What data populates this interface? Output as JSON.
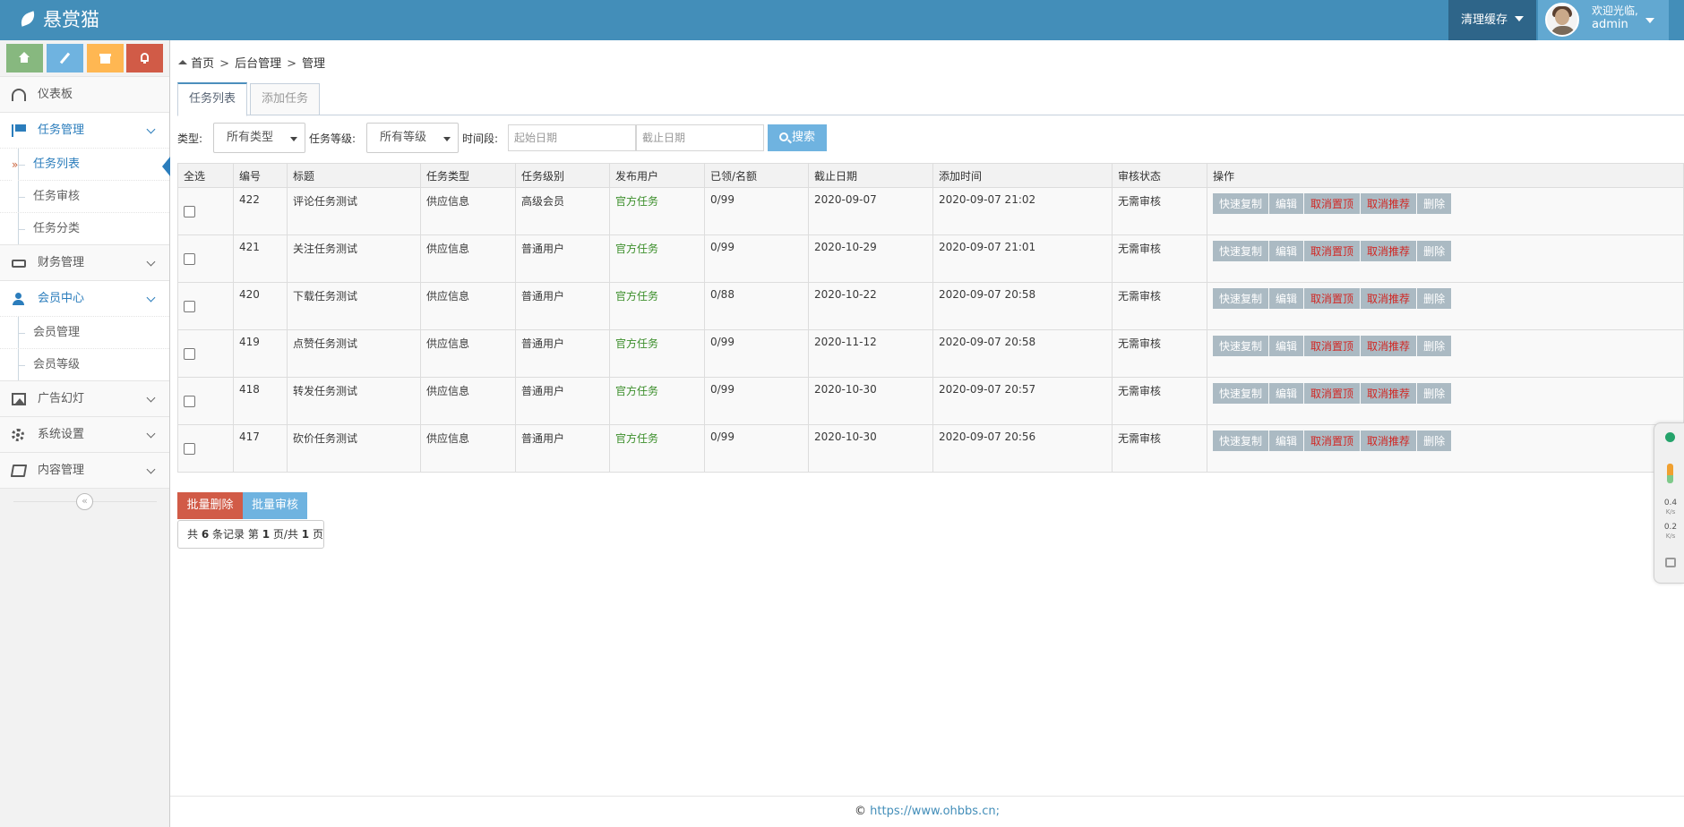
{
  "app": {
    "brand": "悬赏猫"
  },
  "header": {
    "clear_cache": "清理缓存",
    "welcome": "欢迎光临,",
    "username": "admin"
  },
  "shortcuts": [
    {
      "icon": "home-icon",
      "color": "#87b87f"
    },
    {
      "icon": "pencil-icon",
      "color": "#6fb3e0"
    },
    {
      "icon": "gift-icon",
      "color": "#ffb752"
    },
    {
      "icon": "bell-icon",
      "color": "#d15b47"
    }
  ],
  "sidebar": {
    "dashboard": "仪表板",
    "task_mgmt": "任务管理",
    "task_list": "任务列表",
    "task_audit": "任务审核",
    "task_category": "任务分类",
    "finance": "财务管理",
    "member_center": "会员中心",
    "member_mgmt": "会员管理",
    "member_level": "会员等级",
    "ad_slides": "广告幻灯",
    "system_settings": "系统设置",
    "content_mgmt": "内容管理",
    "active_marker": "»",
    "collapse_glyph": "«"
  },
  "breadcrumb": {
    "home": "首页",
    "admin": "后台管理",
    "current": "管理",
    "sep": ">"
  },
  "tabs": {
    "list": "任务列表",
    "add": "添加任务"
  },
  "filter": {
    "type_label": "类型:",
    "type_value": "所有类型",
    "level_label": "任务等级:",
    "level_value": "所有等级",
    "period_label": "时间段:",
    "start_placeholder": "起始日期",
    "end_placeholder": "截止日期",
    "search": "搜索"
  },
  "table": {
    "headers": [
      "全选",
      "编号",
      "标题",
      "任务类型",
      "任务级别",
      "发布用户",
      "已领/名额",
      "截止日期",
      "添加时间",
      "审核状态",
      "操作"
    ],
    "rows": [
      {
        "id": "422",
        "title": "评论任务测试",
        "type": "供应信息",
        "level": "高级会员",
        "publisher": "官方任务",
        "quota": "0/99",
        "deadline": "2020-09-07",
        "added": "2020-09-07 21:02",
        "status": "无需审核"
      },
      {
        "id": "421",
        "title": "关注任务测试",
        "type": "供应信息",
        "level": "普通用户",
        "publisher": "官方任务",
        "quota": "0/99",
        "deadline": "2020-10-29",
        "added": "2020-09-07 21:01",
        "status": "无需审核"
      },
      {
        "id": "420",
        "title": "下载任务测试",
        "type": "供应信息",
        "level": "普通用户",
        "publisher": "官方任务",
        "quota": "0/88",
        "deadline": "2020-10-22",
        "added": "2020-09-07 20:58",
        "status": "无需审核"
      },
      {
        "id": "419",
        "title": "点赞任务测试",
        "type": "供应信息",
        "level": "普通用户",
        "publisher": "官方任务",
        "quota": "0/99",
        "deadline": "2020-11-12",
        "added": "2020-09-07 20:58",
        "status": "无需审核"
      },
      {
        "id": "418",
        "title": "转发任务测试",
        "type": "供应信息",
        "level": "普通用户",
        "publisher": "官方任务",
        "quota": "0/99",
        "deadline": "2020-10-30",
        "added": "2020-09-07 20:57",
        "status": "无需审核"
      },
      {
        "id": "417",
        "title": "砍价任务测试",
        "type": "供应信息",
        "level": "普通用户",
        "publisher": "官方任务",
        "quota": "0/99",
        "deadline": "2020-10-30",
        "added": "2020-09-07 20:56",
        "status": "无需审核"
      }
    ],
    "actions": [
      "快速复制",
      "编辑",
      "取消置顶",
      "取消推荐",
      "删除"
    ]
  },
  "batch": {
    "delete": "批量删除",
    "audit": "批量审核"
  },
  "pager": {
    "prefix": "共",
    "total": "6",
    "mid1": "条记录 第",
    "page": "1",
    "mid2": "页/共",
    "pages": "1",
    "suffix": "页"
  },
  "footer": {
    "copyright": "©",
    "link": "https://www.ohbbs.cn;"
  },
  "widget": {
    "up_speed": "0.4",
    "up_unit": "K/s",
    "down_speed": "0.2",
    "down_unit": "K/s"
  },
  "colors": {
    "nav_bg": "#438eb9",
    "accent": "#2b7dbc",
    "danger": "#d15b47",
    "info": "#6fb3e0",
    "ok_green": "#3b8e2a"
  }
}
